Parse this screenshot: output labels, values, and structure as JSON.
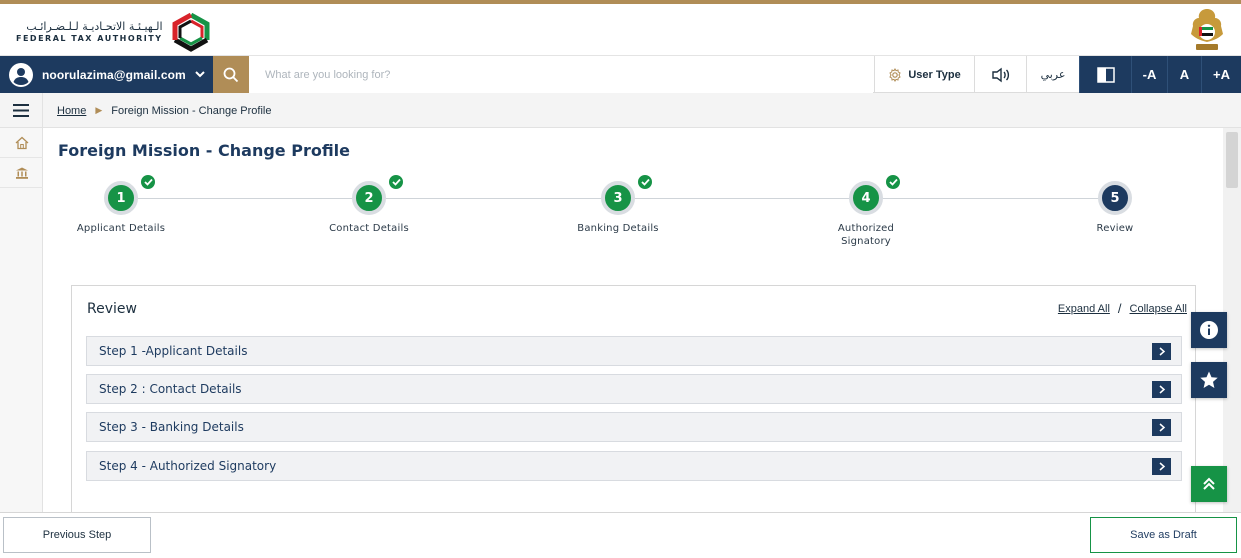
{
  "header": {
    "logo_arabic": "الـهيـئـة الاتحـاديـة لـلـضـرائـب",
    "logo_english": "FEDERAL TAX AUTHORITY"
  },
  "navbar": {
    "user_email": "noorulazima@gmail.com",
    "search_placeholder": "What are you looking for?",
    "user_type_label": "User Type",
    "language_label": "عربي",
    "font_decrease": "-A",
    "font_normal": "A",
    "font_increase": "+A"
  },
  "breadcrumb": {
    "home": "Home",
    "current": "Foreign Mission - Change Profile"
  },
  "page": {
    "title": "Foreign Mission - Change Profile"
  },
  "stepper": {
    "steps": [
      {
        "number": "1",
        "label": "Applicant Details",
        "status": "done"
      },
      {
        "number": "2",
        "label": "Contact Details",
        "status": "done"
      },
      {
        "number": "3",
        "label": "Banking Details",
        "status": "done"
      },
      {
        "number": "4",
        "label": "Authorized Signatory",
        "status": "done"
      },
      {
        "number": "5",
        "label": "Review",
        "status": "active"
      }
    ]
  },
  "review": {
    "title": "Review",
    "expand_all": "Expand All",
    "separator": "/",
    "collapse_all": "Collapse All",
    "sections": [
      {
        "label": "Step 1 -Applicant Details"
      },
      {
        "label": "Step 2 : Contact Details"
      },
      {
        "label": "Step 3 - Banking Details"
      },
      {
        "label": "Step 4 - Authorized Signatory"
      }
    ]
  },
  "footer": {
    "previous": "Previous Step",
    "save_draft": "Save as Draft"
  },
  "colors": {
    "navy": "#1d3a5f",
    "gold": "#b08d57",
    "green": "#169346"
  }
}
